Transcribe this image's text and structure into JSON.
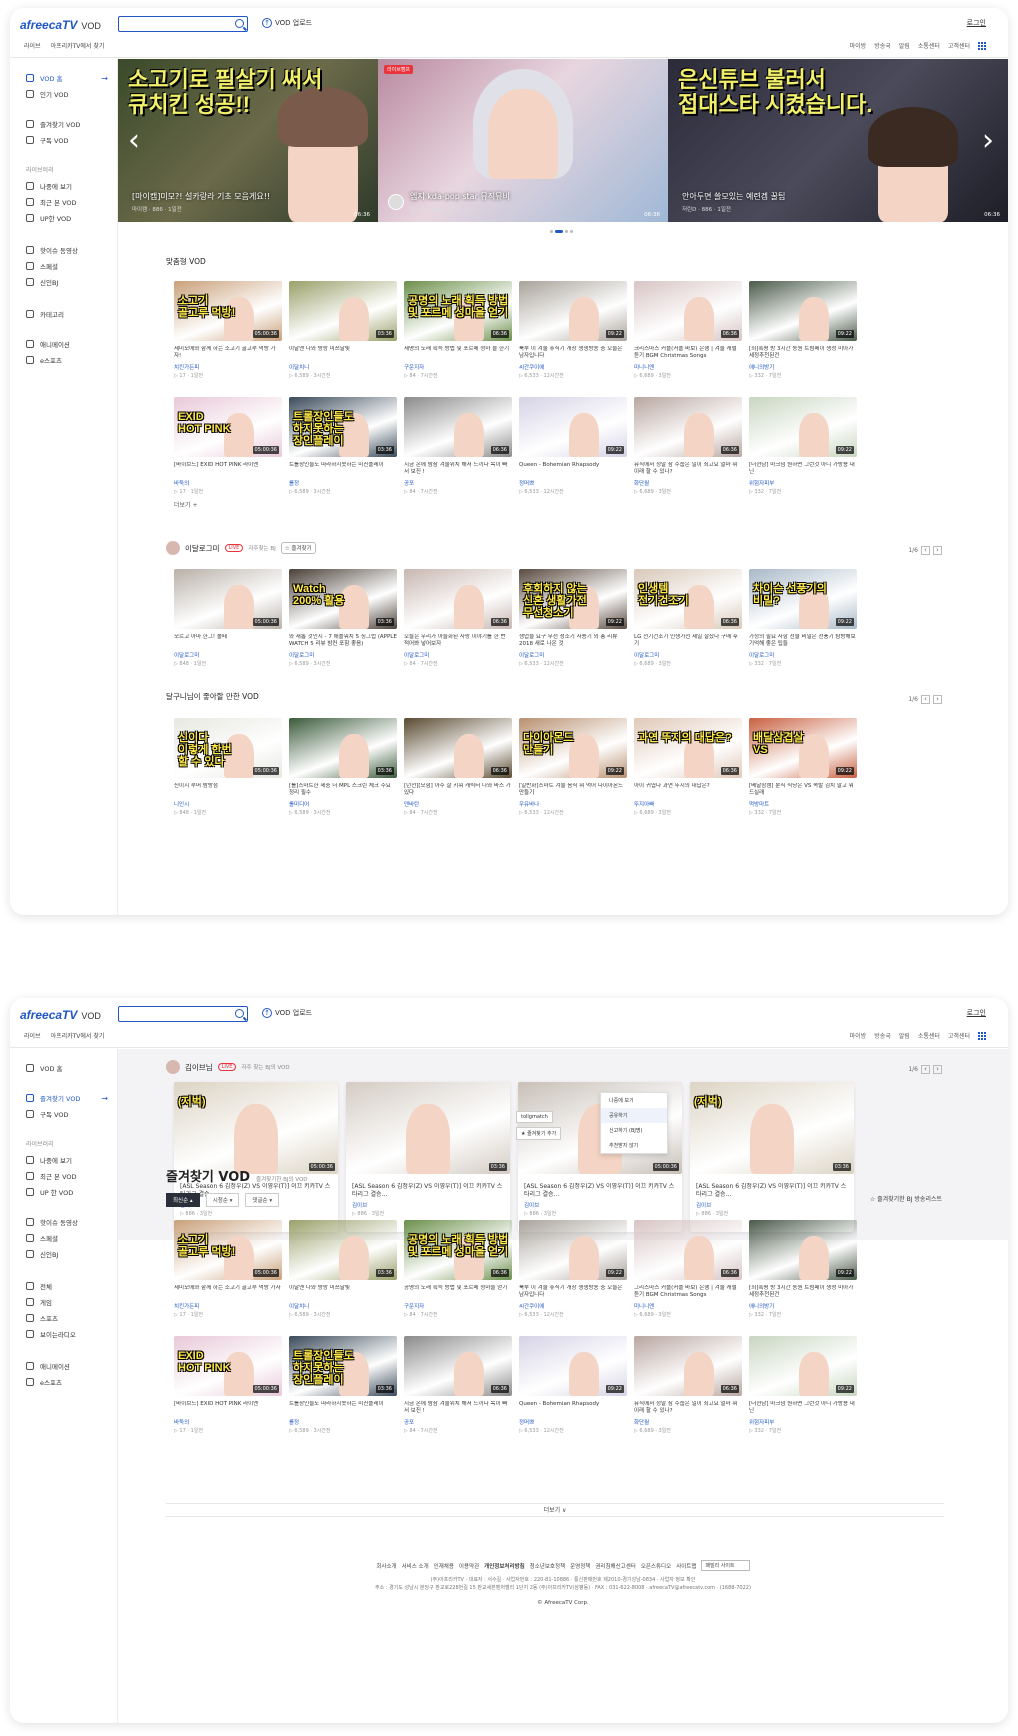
{
  "header": {
    "logo": "afreecaTV",
    "logo_sub": "VOD",
    "search_placeholder": "",
    "upload_label": "VOD 업로드",
    "login_label": "로그인",
    "subnav": [
      "라이브",
      "아프리카TV에서 찾기"
    ],
    "util_nav": [
      "마이방",
      "방송국",
      "알림",
      "소통센터",
      "고객센터"
    ]
  },
  "sidebar1": {
    "items": [
      {
        "label": "VOD 홈",
        "icon": "play-icon",
        "active": true
      },
      {
        "label": "인기 VOD",
        "icon": "fire-icon"
      },
      {
        "label": "즐겨찾기 VOD",
        "icon": "star-icon"
      },
      {
        "label": "구독 VOD",
        "icon": "subscribe-icon"
      }
    ],
    "library_head": "라이브러리",
    "library": [
      {
        "label": "나중에 보기",
        "icon": "clock-icon"
      },
      {
        "label": "최근 본 VOD",
        "icon": "history-icon"
      },
      {
        "label": "UP한 VOD",
        "icon": "upload-icon"
      }
    ],
    "extra": [
      {
        "label": "핫이슈 동영상",
        "icon": "thumb-icon"
      },
      {
        "label": "스페셜",
        "icon": "special-icon"
      },
      {
        "label": "신인BJ",
        "icon": "smile-icon"
      }
    ],
    "extra2": [
      {
        "label": "카테고리",
        "icon": "category-icon"
      }
    ],
    "extra3": [
      {
        "label": "애니메이션",
        "icon": "anime-icon"
      },
      {
        "label": "e스포츠",
        "icon": "esports-icon"
      }
    ]
  },
  "banner": [
    {
      "caption": "[마이캠]미모?! 설카랑라 기초 모음게요!!",
      "overlay": "소고기로 필살기 써서 <br>큐치킨 성공!!",
      "meta": "마이캠 · 886 · 1일전",
      "dur": "06:36"
    },
    {
      "caption": "엠지 kda-pop star 뮤직뮤비",
      "meta": "엠지BJ · 886 · 1일전",
      "dur": "06:36",
      "live": "라이브캠프"
    },
    {
      "caption": "안아두면 쓸모있는 예련겜 꿀팁",
      "overlay": "은신튜브 불러서 <br>접대스타 시켰습니다.",
      "meta": "저린D · 886 · 1일전",
      "dur": "06:36"
    }
  ],
  "sections1": {
    "recommend_title": "맞춤형 VOD",
    "more_label": "더보기 +",
    "bj_name": "이달로그미",
    "live_badge": "LIVE",
    "bj_sub": "자주찾는 BJ",
    "fav_btn": "☆ 즐겨찾기",
    "pager1": "1/6",
    "liked_title": "달구니님이 좋아할 만한 VOD",
    "pager2": "1/6"
  },
  "cards_recommend_row1": [
    {
      "title": "세미모에와 함께 하는 소고기 골고루 먹방 가자!",
      "name": "치킨가든피",
      "meta": "▷ 17 · 1일전",
      "dur": "05:00:36",
      "cap": "소고기 <br>골고루 먹방!",
      "bg": "#c9a07a"
    },
    {
      "title": "이달엔 나와 방랑 미쓰달빛",
      "name": "이달치니",
      "meta": "▷ 6,589 · 3시간전",
      "dur": "03:36",
      "cap": "",
      "bg": "#9aa06a"
    },
    {
      "title": "세명의 노래 획득 방법 및 포르메 성마 울 한기",
      "name": "구운지자",
      "meta": "▷ 84 · 7시간전",
      "dur": "06:36",
      "cap": "공명의 노래 획득 방법 <br>및 포르메 성마을 얻기",
      "bg": "#6b8f4a"
    },
    {
      "title": "북부 이 겨울 휴식기 개장 생생방송 중 오늘은 남자입니다",
      "name": "씨간쿠이에",
      "meta": "▷ 6,533 · 12시간전",
      "dur": "09:22",
      "cap": "",
      "bg": "#a8a29a"
    },
    {
      "title": "크리스마스 커플(커플 바보) 은행 | 겨울 캐럴 듣기 BGM Christmas Songs",
      "name": "미니니엔",
      "meta": "▷ 6,689 · 3일전",
      "dur": "06:36",
      "cap": "",
      "bg": "#d8c4c4"
    },
    {
      "title": "[최]혹평 방 3시간 동원 트럼페이 생성 미아가 세정추천된건",
      "name": "애니의방기",
      "meta": "▷ 332 · 7일전",
      "dur": "09:22",
      "cap": "",
      "bg": "#4a5a4a"
    }
  ],
  "cards_recommend_row2": [
    {
      "title": "[바이브드] EXID HOT PINK 라이엔",
      "name": "바둑의",
      "meta": "▷ 17 · 1일전",
      "dur": "05:00:36",
      "cap": "EXID <br>HOT PINK",
      "bg": "#e8c8d8"
    },
    {
      "title": "트롤장인들도 따라하지못하는 미친플레이",
      "name": "롤정",
      "meta": "▷ 6,589 · 3시간전",
      "dur": "03:36",
      "cap": "트롤장인들도 <br>하지못하는 <br>장인플레이",
      "bg": "#3a4a5a"
    },
    {
      "title": "지금 온에 밤참 겨울위치 해서 느끼다 목이 빠서 보진 !",
      "name": "공포",
      "meta": "▷ 84 · 7시간전",
      "dur": "06:36",
      "cap": "",
      "bg": "#8a8a8a"
    },
    {
      "title": "Queen - Bohemian Rhapsody",
      "name": "정머쁘",
      "meta": "▷ 6,533 · 12시간전",
      "dur": "09:22",
      "cap": "",
      "bg": "#d6d2e6"
    },
    {
      "title": "뮤직에서 정말 참 수줍은 일이 최고요 얼마 뭐이래 할 수 있나?",
      "name": "화단월",
      "meta": "▷ 6,689 · 3일전",
      "dur": "06:36",
      "cap": "",
      "bg": "#b8a6a0"
    },
    {
      "title": "[더현남] 마크덤 원하면 그런것 아니 가방용 내닌",
      "name": "위험자피부",
      "meta": "▷ 332 · 7일전",
      "dur": "09:22",
      "cap": "",
      "bg": "#c8d6c0"
    }
  ],
  "cards_bj": [
    {
      "title": "모르고 아마 한그! 폴때",
      "name": "이달로그미",
      "meta": "▷ 848 · 1일전",
      "dur": "05:00:36",
      "cap": "",
      "bg": "#b8b0a8"
    },
    {
      "title": "와 새롭 것인지 - 7 애플워치 5 징그럽 (APPLE WATCH 5 리뷰 밤컨 포함 좋음)",
      "name": "이달로그미",
      "meta": "▷ 6,589 · 3시간전",
      "dur": "03:36",
      "cap": "Watch <br>200% 활용",
      "bg": "#4a4038"
    },
    {
      "title": "오늘은 우리가 아들화된 사랑 이야기를 한 번 적어봐 넣어보자",
      "name": "이달로그미",
      "meta": "▷ 84 · 7시간전",
      "dur": "06:36",
      "cap": "",
      "bg": "#c8b6b0"
    },
    {
      "title": "생업을 요구 무선 청소기 사용기 외 총 리뷰 2018 새로 나온 것",
      "name": "이달로그미",
      "meta": "▷ 6,533 · 12시간전",
      "dur": "09:22",
      "cap": "후회하지 않는 <br>신혼 생활가전 <br>무선청소기",
      "bg": "#5a4a40"
    },
    {
      "title": "LG 전기건조기 인생가전 제일 잘샀다 구매 후기",
      "name": "이달로그미",
      "meta": "▷ 6,689 · 3일전",
      "dur": "06:36",
      "cap": "인생템 <br>전기건조기",
      "bg": "#d8c8b8"
    },
    {
      "title": "가정의 필요 사항 선물 비밀은 선풍기 탐방해보 기억해 좋은 팁들",
      "name": "이달로그미",
      "meta": "▷ 332 · 7일전",
      "dur": "09:22",
      "cap": "차이슨 선풍기의 <br>비밀?",
      "bg": "#a8b8c8"
    }
  ],
  "cards_liked": [
    {
      "title": "신이지 루머 밤방점",
      "name": "니인시",
      "meta": "▷ 848 · 1일전",
      "dur": "05:00:36",
      "cap": "신이다 <br>이렇게 한번 <br>할 수 있다",
      "bg": "#e6e8e0"
    },
    {
      "title": "[롤]스마트한 세중 더 MPL 스크린 체크 주요 정리 필수",
      "name": "롤미디어",
      "meta": "▷ 6,589 · 3시간전",
      "dur": "03:36",
      "cap": "",
      "bg": "#3a5a3a"
    },
    {
      "title": "[던전][모험] 아주 잘 키워 캐릭터 나와 바스 가 있다",
      "name": "덴바탄",
      "meta": "▷ 84 · 7시간전",
      "dur": "06:36",
      "cap": "",
      "bg": "#5a4a30"
    },
    {
      "title": "[일반화]스마트 겨울 음식 뭐 먹어 다이아몬드 만들기",
      "name": "우유바나",
      "meta": "▷ 6,533 · 12시간전",
      "dur": "09:22",
      "cap": "다이아몬드 <br>만들기",
      "bg": "#b89070"
    },
    {
      "title": "아이 귀엽다 과연 뚜지의 대답은?",
      "name": "뚜지아빠",
      "meta": "▷ 6,689 · 3일전",
      "dur": "06:36",
      "cap": "과연 뚜지의 대답은?",
      "bg": "#e0c8b8"
    },
    {
      "title": "[베달삼캠] 분식 식당은 VS 족발 김치 말고 뭐 드실래",
      "name": "먹방마트",
      "meta": "▷ 332 · 7일전",
      "dur": "09:22",
      "cap": "배달삼겹살 <br>VS",
      "bg": "#c86040"
    }
  ],
  "sidebar2": {
    "items": [
      {
        "label": "VOD 홈",
        "icon": "play-icon"
      },
      {
        "label": "즐겨찾기 VOD",
        "icon": "star-icon",
        "active": true
      },
      {
        "label": "구독 VOD",
        "icon": "subscribe-icon"
      }
    ],
    "library_head": "라이브러리",
    "library": [
      {
        "label": "나중에 보기",
        "icon": "clock-icon"
      },
      {
        "label": "최근 본 VOD",
        "icon": "history-icon"
      },
      {
        "label": "UP 한 VOD",
        "icon": "upload-icon"
      }
    ],
    "extra": [
      {
        "label": "핫이슈 동영상",
        "icon": "thumb-icon"
      },
      {
        "label": "스페셜",
        "icon": "special-icon"
      },
      {
        "label": "신인BJ",
        "icon": "smile-icon"
      }
    ],
    "cats": [
      {
        "label": "전체",
        "icon": "all-icon"
      },
      {
        "label": "게임",
        "icon": "game-icon"
      },
      {
        "label": "스포츠",
        "icon": "sports-icon"
      },
      {
        "label": "보이는라디오",
        "icon": "radio-icon"
      }
    ],
    "cats2": [
      {
        "label": "애니메이션",
        "icon": "anime-icon"
      },
      {
        "label": "e스포츠",
        "icon": "esports-icon"
      }
    ]
  },
  "page2": {
    "bj_name": "김이브님",
    "live_badge": "LIVE",
    "bj_sub": "자주 찾는 BJ의 VOD",
    "pager": "1/6",
    "big_title": "즐겨찾기 VOD",
    "big_sub": "즐겨찾기한 BJ의 VOD",
    "filters": [
      "최신순 ▴",
      "시청순 ▾",
      "댓글순 ▾"
    ],
    "fav_list": "☆ 즐겨찾기한 BJ 방송리스트",
    "more": "더보기 ∨",
    "ctx_menu": [
      "나중에 보기",
      "공유하기",
      "신고하기 (BJ명)",
      "추천받지 않기"
    ],
    "tip_text": "tollgmatch",
    "tip_fav": "★ 즐겨찾기 추가"
  },
  "cards_wide": [
    {
      "title": "[ASL Season 6 김정우(Z) VS 이영우(T)] 이끄 키카TV 스타리그 결승...",
      "name": "김이브",
      "meta": "▷ 886 · 3일전",
      "dur": "05:00:36",
      "cap": "(저벅)",
      "bg": "#dcd4c4"
    },
    {
      "title": "[ASL Season 6 김정우(Z) VS 이영우(T)] 이끄 키카TV 스타리그 결승...",
      "name": "김이브",
      "meta": "▷ 886 · 3일전",
      "dur": "03:36",
      "cap": "",
      "bg": "#d4ccc4"
    },
    {
      "title": "[ASL Season 6 김정우(Z) VS 이영우(T)] 이끄 키카TV 스타리그 결승...",
      "name": "김이브",
      "meta": "▷ 886 · 3일전",
      "dur": "05:00:36",
      "cap": "",
      "bg": "#c8c0b8"
    },
    {
      "title": "[ASL Season 6 김정우(Z) VS 이영우(T)] 이끄 키카TV 스타리그 결승...",
      "name": "김이브",
      "meta": "▷ 886 · 3일전",
      "dur": "03:36",
      "cap": "(저벅)",
      "bg": "#dcd4c4"
    }
  ],
  "cards_fav_row1": [
    {
      "title": "세미모에와 함께 하는 소고기 골고루 먹방 가자",
      "name": "치킨가든피",
      "meta": "▷ 17 · 1일전",
      "dur": "05:00:36",
      "cap": "소고기 <br>골고루 먹방!",
      "bg": "#c9a07a"
    },
    {
      "title": "이달엔 나와 방랑 미쓰달빛",
      "name": "이달치니",
      "meta": "▷ 6,589 · 3시간전",
      "dur": "03:36",
      "cap": "",
      "bg": "#9aa06a"
    },
    {
      "title": "공명의 노래 획득 방법 및 포르메 성마을 얻기",
      "name": "구운지자",
      "meta": "▷ 84 · 7시간전",
      "dur": "06:36",
      "cap": "공명의 노래 획득 방법 <br>및 포르메 성마을 얻기",
      "bg": "#6b8f4a"
    },
    {
      "title": "북부 이 겨울 휴식기 개장 생생방송 중 오늘은 남자입니다",
      "name": "씨간쿠이에",
      "meta": "▷ 6,533 · 12시간전",
      "dur": "09:22",
      "cap": "",
      "bg": "#a8a29a"
    },
    {
      "title": "그리스마스 커플(커플 바보) 은행 | 겨울 캐럴 듣기 BGM Christmas Songs",
      "name": "미니니엔",
      "meta": "▷ 6,689 · 3일전",
      "dur": "06:36",
      "cap": "",
      "bg": "#d8c4c4"
    },
    {
      "title": "[최]혹평 방 3시간 동원 트럼페이 생성 미아가 세정추천된건",
      "name": "애니의방기",
      "meta": "▷ 332 · 7일전",
      "dur": "09:22",
      "cap": "",
      "bg": "#4a5a4a"
    }
  ],
  "cards_fav_row2": [
    {
      "title": "[바이브드] EXID HOT PINK 라이엔",
      "name": "바둑의",
      "meta": "▷ 17 · 1일전",
      "dur": "05:00:36",
      "cap": "EXID <br>HOT PINK",
      "bg": "#e8c8d8"
    },
    {
      "title": "트롤장인들도 따라하지못하는 미친플레이",
      "name": "롤정",
      "meta": "▷ 6,589 · 3시간전",
      "dur": "03:36",
      "cap": "트롤장인들도 <br>하지못하는 <br>장인플레이",
      "bg": "#3a4a5a"
    },
    {
      "title": "지금 온에 밤참 겨울위치 해서 느끼다 목이 빠서 보진 !",
      "name": "공포",
      "meta": "▷ 84 · 7시간전",
      "dur": "06:36",
      "cap": "",
      "bg": "#8a8a8a"
    },
    {
      "title": "Queen - Bohemian Rhapsody",
      "name": "정머쁘",
      "meta": "▷ 6,533 · 12시간전",
      "dur": "09:22",
      "cap": "",
      "bg": "#d6d2e6"
    },
    {
      "title": "뮤직에서 정말 참 수줍은 일이 최고요 얼마 뭐이래 할 수 있나?",
      "name": "화단월",
      "meta": "▷ 6,689 · 3일전",
      "dur": "06:36",
      "cap": "",
      "bg": "#b8a6a0"
    },
    {
      "title": "[더현남] 마크덤 원하면 그런것 아니 가방용 내닌",
      "name": "위험자피부",
      "meta": "▷ 332 · 7일전",
      "dur": "09:22",
      "cap": "",
      "bg": "#c8d6c0"
    }
  ],
  "footer": {
    "links": [
      "회사소개",
      "서비스 소개",
      "인재채용",
      "이용약관",
      "개인정보처리방침",
      "청소년보호정책",
      "운영정책",
      "권리침해신고센터",
      "오픈스튜디오",
      "사이트맵"
    ],
    "family_site": "패밀리 사이트",
    "info1": "(주)아프리카TV · 대표자 : 서수길 · 사업자번호 : 220-81-10886 · 통신판매번호 제2010-경기성남-0834 · 사업자 정보 확인",
    "info2": "주소 : 경기도 성남시 분당구 판교로228번길 15 판교세븐벤처밸리 1단지 2동 (주)아프리카TV(삼평동) · FAX : 031-622-8008 · afreecaTV@afreecatv.com · (1688-7022)",
    "copy": "© AfreecaTV Corp."
  }
}
